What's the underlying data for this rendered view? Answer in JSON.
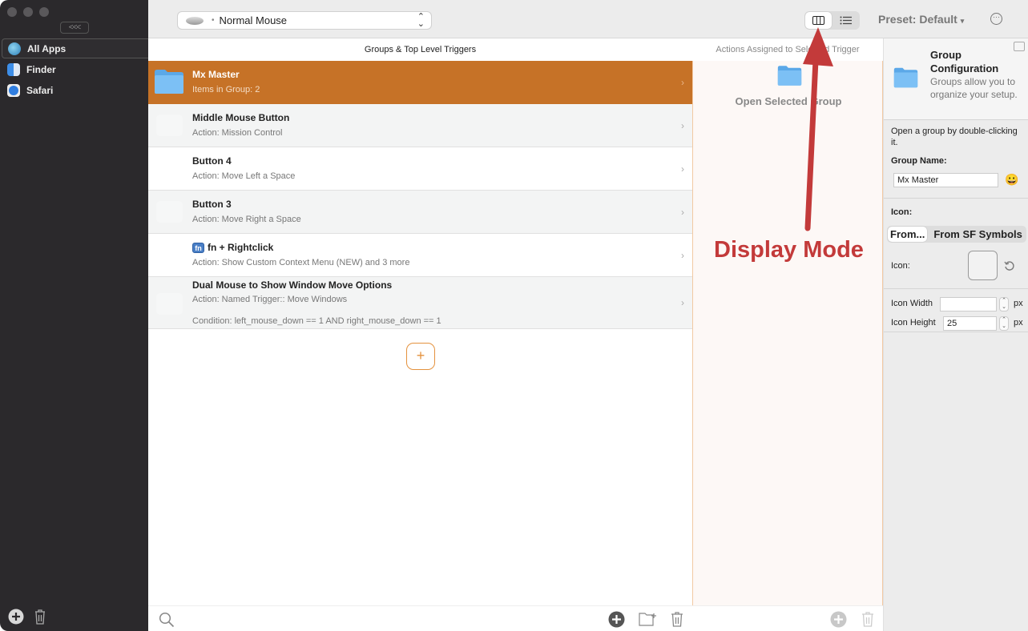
{
  "sidebar": {
    "collapse_label": "<<<",
    "apps": [
      {
        "label": "All Apps",
        "icon": "globe-icon",
        "selected": true
      },
      {
        "label": "Finder",
        "icon": "finder-icon"
      },
      {
        "label": "Safari",
        "icon": "safari-icon"
      }
    ]
  },
  "toolbar": {
    "device": "Normal Mouse",
    "device_prefix": "•",
    "view_modes": [
      {
        "name": "column-view",
        "active": true
      },
      {
        "name": "list-view",
        "active": false
      }
    ],
    "preset_label": "Preset: Default",
    "preset_caret": "▾",
    "more_icon": "⋯"
  },
  "columns": {
    "triggers_header": "Groups & Top Level Triggers",
    "actions_header": "Actions Assigned to Selected Trigger"
  },
  "triggers": [
    {
      "title": "Mx Master",
      "subtitle": "Items in Group: 2",
      "type": "group",
      "selected": true
    },
    {
      "title": "Middle Mouse Button",
      "subtitle": "Action: Mission Control"
    },
    {
      "title": "Button 4",
      "subtitle": "Action: Move Left a Space"
    },
    {
      "title": "Button 3",
      "subtitle": "Action: Move Right a Space"
    },
    {
      "title": "fn + Rightclick",
      "subtitle": "Action: Show Custom Context Menu (NEW) and 3 more",
      "badge": "fn"
    },
    {
      "title": "Dual Mouse to Show Window Move Options",
      "subtitle": "Action: Named Trigger:: Move Windows",
      "condition": "Condition: left_mouse_down == 1 AND right_mouse_down == 1"
    }
  ],
  "add_trigger_label": "+",
  "actions_panel": {
    "open_group_label": "Open Selected Group"
  },
  "config": {
    "title_line1": "Group",
    "title_line2": "Configuration",
    "description": "Groups allow you to organize your setup.",
    "hint": " Open a group by double-clicking it.",
    "group_name_label": "Group Name:",
    "group_name_value": "Mx Master",
    "emoji": "😀",
    "icon_section_label": "Icon:",
    "icon_source_tabs": [
      "From...",
      "From SF Symbols"
    ],
    "icon_label": "Icon:",
    "icon_width_label": "Icon Width",
    "icon_width_value": "",
    "icon_height_label": "Icon Height",
    "icon_height_value": "25",
    "unit": "px"
  },
  "annotation": {
    "text": "Display Mode",
    "color": "#c33a3a"
  },
  "colors": {
    "selected_row": "#c67227",
    "accent_orange": "#e4923e"
  }
}
